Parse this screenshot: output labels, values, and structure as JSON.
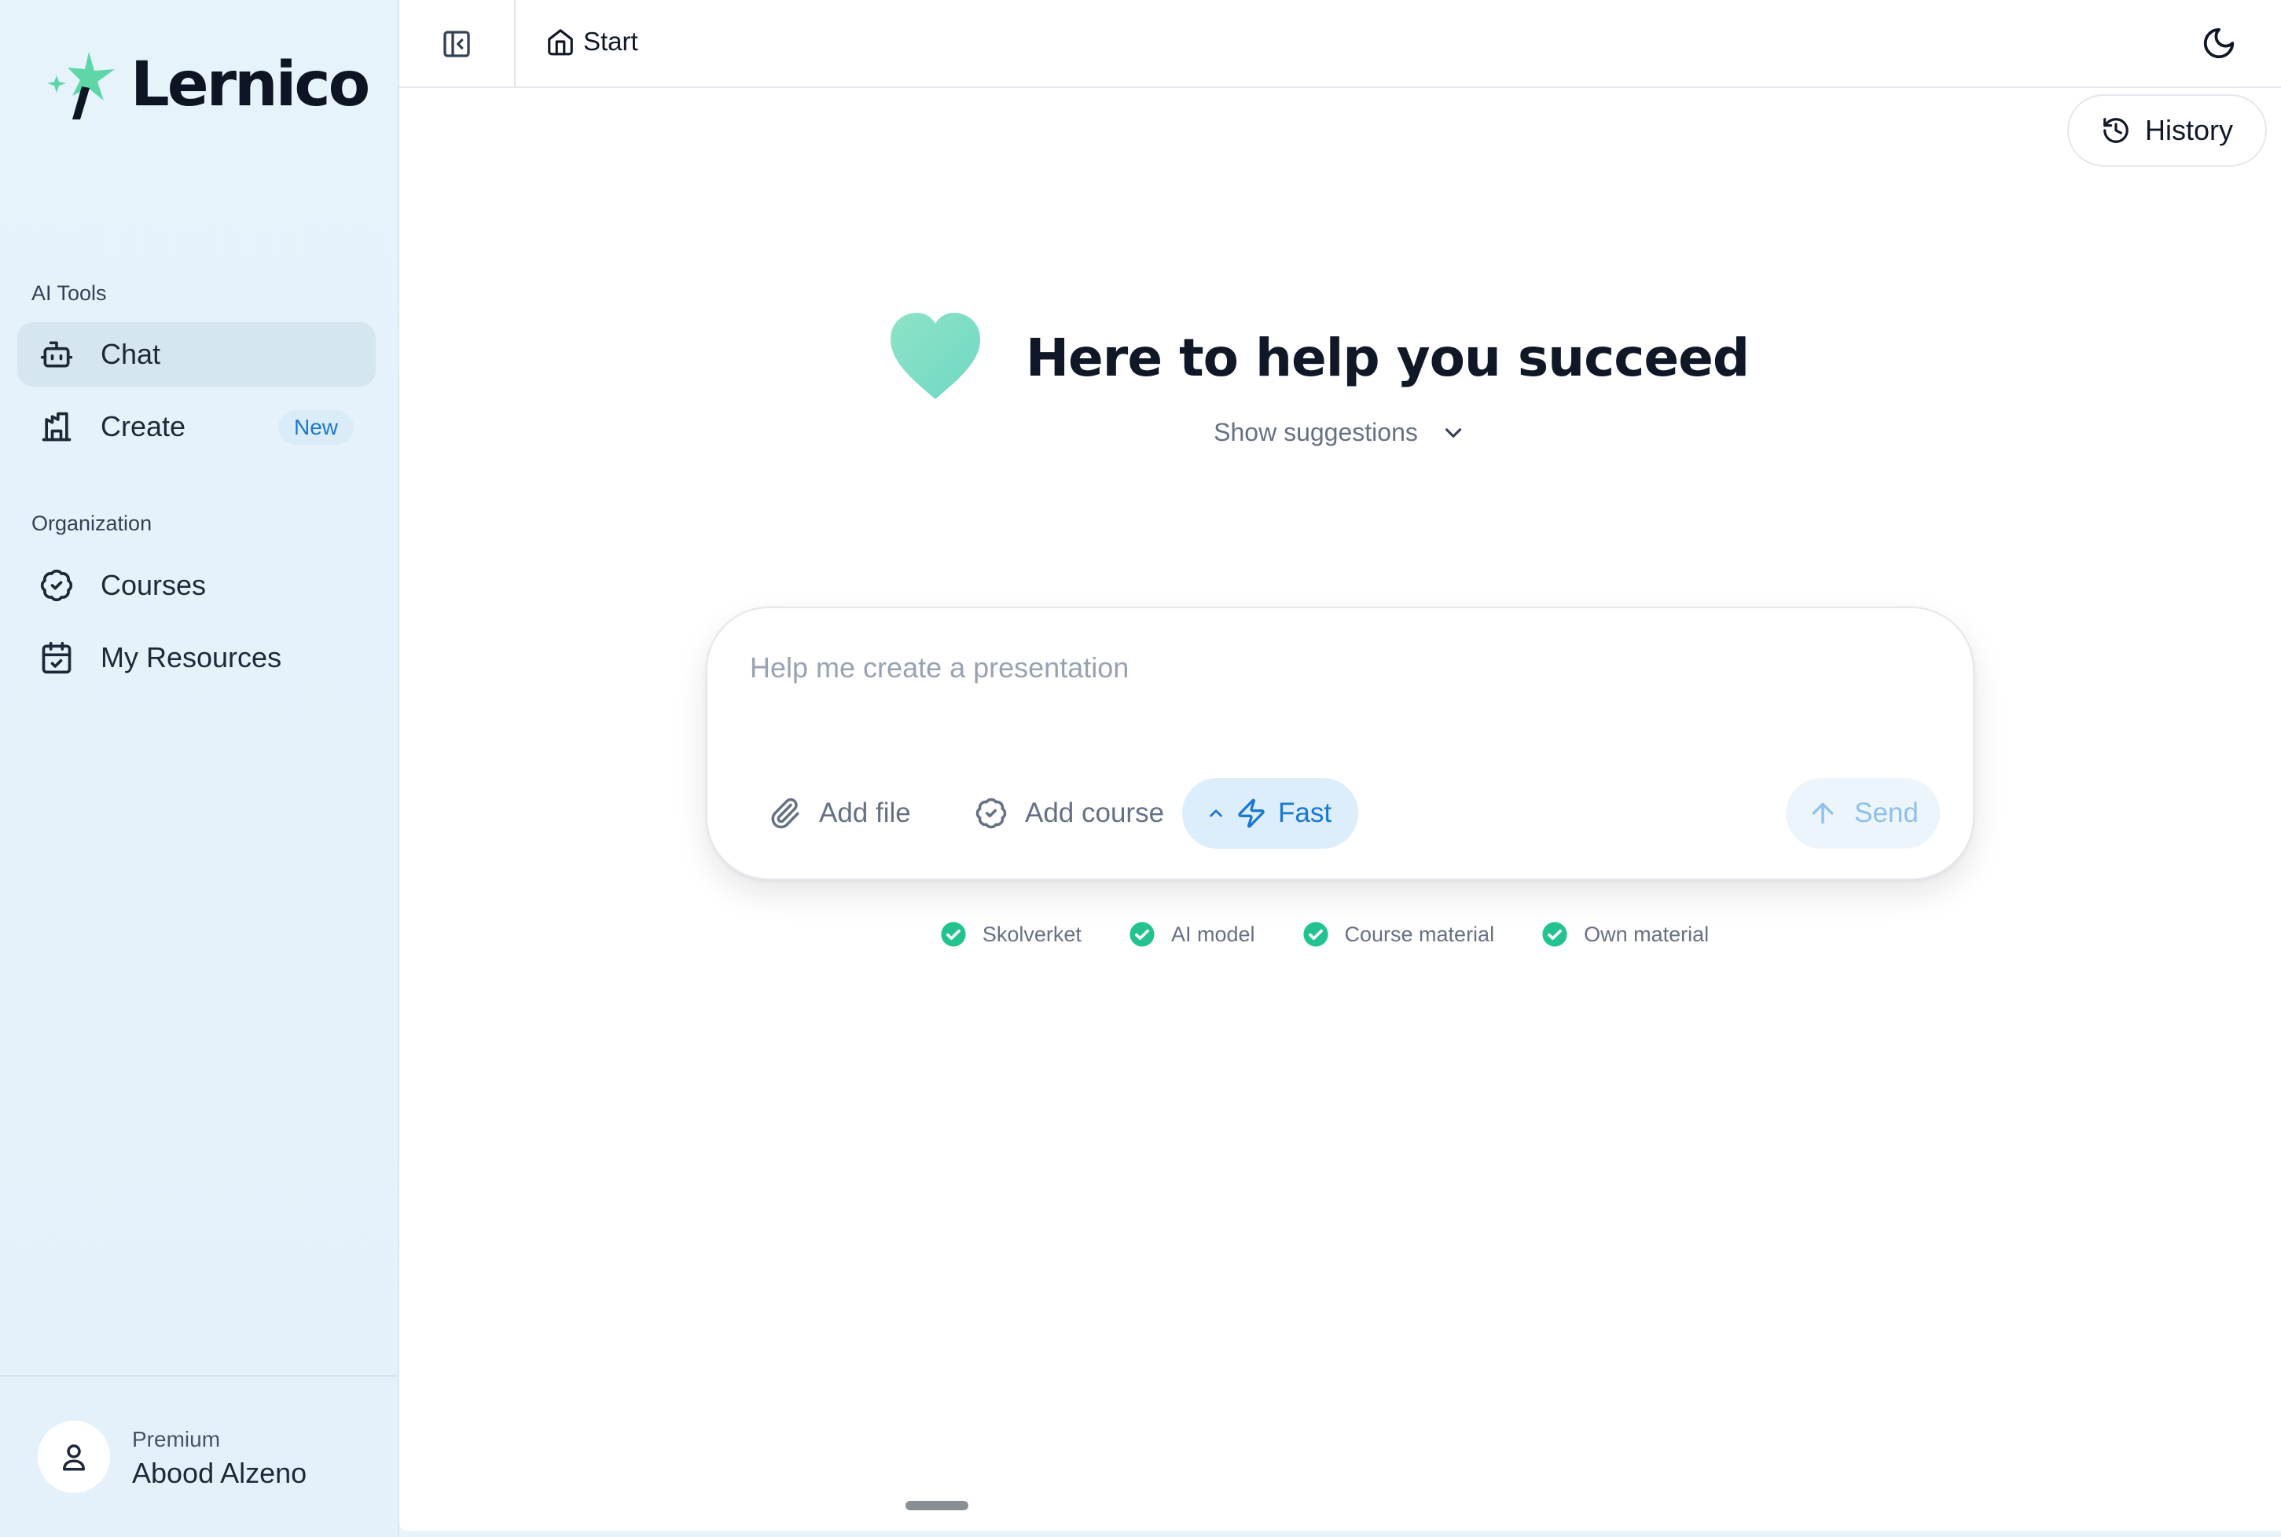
{
  "sidebar": {
    "brand": "Lernico",
    "sections": [
      {
        "label": "AI Tools",
        "items": [
          {
            "label": "Chat",
            "icon": "bot-icon",
            "active": true
          },
          {
            "label": "Create",
            "icon": "blocks-icon",
            "badge": "New"
          }
        ]
      },
      {
        "label": "Organization",
        "items": [
          {
            "label": "Courses",
            "icon": "badge-check-icon"
          },
          {
            "label": "My Resources",
            "icon": "calendar-check-icon"
          }
        ]
      }
    ],
    "user": {
      "plan": "Premium",
      "name": "Abood Alzeno",
      "icon": "user-icon"
    }
  },
  "topbar": {
    "breadcrumb": "Start",
    "breadcrumb_icon": "home-icon",
    "toggle_icon": "sidebar-toggle-icon",
    "theme_icon": "moon-icon"
  },
  "history": {
    "label": "History",
    "icon": "history-icon"
  },
  "hero": {
    "title": "Here to help you succeed",
    "icon": "heart-icon",
    "suggestions_label": "Show suggestions"
  },
  "composer": {
    "placeholder": "Help me create a presentation",
    "value": "",
    "add_file": "Add file",
    "add_course": "Add course",
    "mode": "Fast",
    "send": "Send"
  },
  "sources": [
    "Skolverket",
    "AI model",
    "Course material",
    "Own material"
  ],
  "colors": {
    "accent": "#1a78d1",
    "sidebar_bg": "#e7f3fb",
    "check_green": "#22c38e",
    "brand_mint": "#5ed6a8"
  }
}
